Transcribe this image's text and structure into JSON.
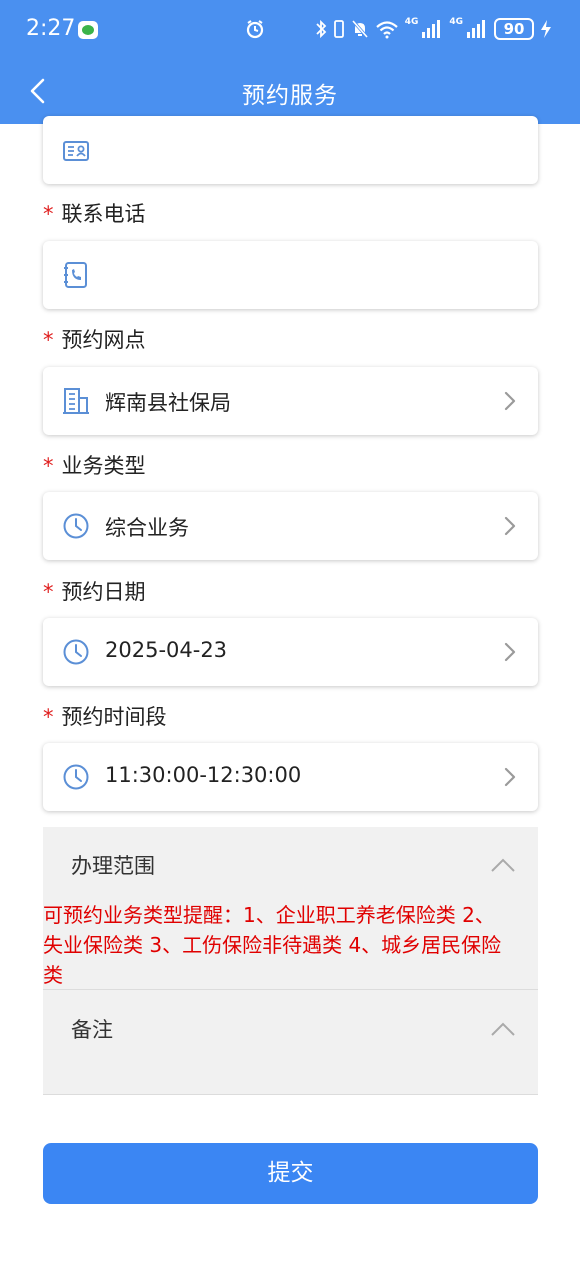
{
  "status_bar": {
    "time": "2:27",
    "net_label_1": "4G",
    "net_label_2": "4G",
    "battery": "90"
  },
  "header": {
    "title": "预约服务"
  },
  "form": {
    "name_value": "",
    "phone_label": "联系电话",
    "phone_value": "",
    "branch_label": "预约网点",
    "branch_value": "辉南县社保局",
    "service_type_label": "业务类型",
    "service_type_value": "综合业务",
    "date_label": "预约日期",
    "date_value": "2025-04-23",
    "time_slot_label": "预约时间段",
    "time_slot_value": "11:30:00-12:30:00",
    "required_mark": "*"
  },
  "scope": {
    "title": "办理范围",
    "reminder": "可预约业务类型提醒：1、企业职工养老保险类 2、失业保险类 3、工伤保险非待遇类 4、城乡居民保险类",
    "remarks_title": "备注"
  },
  "submit": {
    "label": "提交"
  },
  "colors": {
    "header_bg": "#4a90f0",
    "primary_button": "#3b86f3",
    "required_mark": "#e02020",
    "reminder_text": "#e00000",
    "icon_blue": "#5b8fd6"
  },
  "icons": {
    "back": "chevron-left-icon",
    "id_card": "id-card-icon",
    "phone": "phone-book-icon",
    "branch": "building-icon",
    "clock": "clock-icon",
    "forward": "chevron-right-icon",
    "collapse": "chevron-up-icon"
  }
}
